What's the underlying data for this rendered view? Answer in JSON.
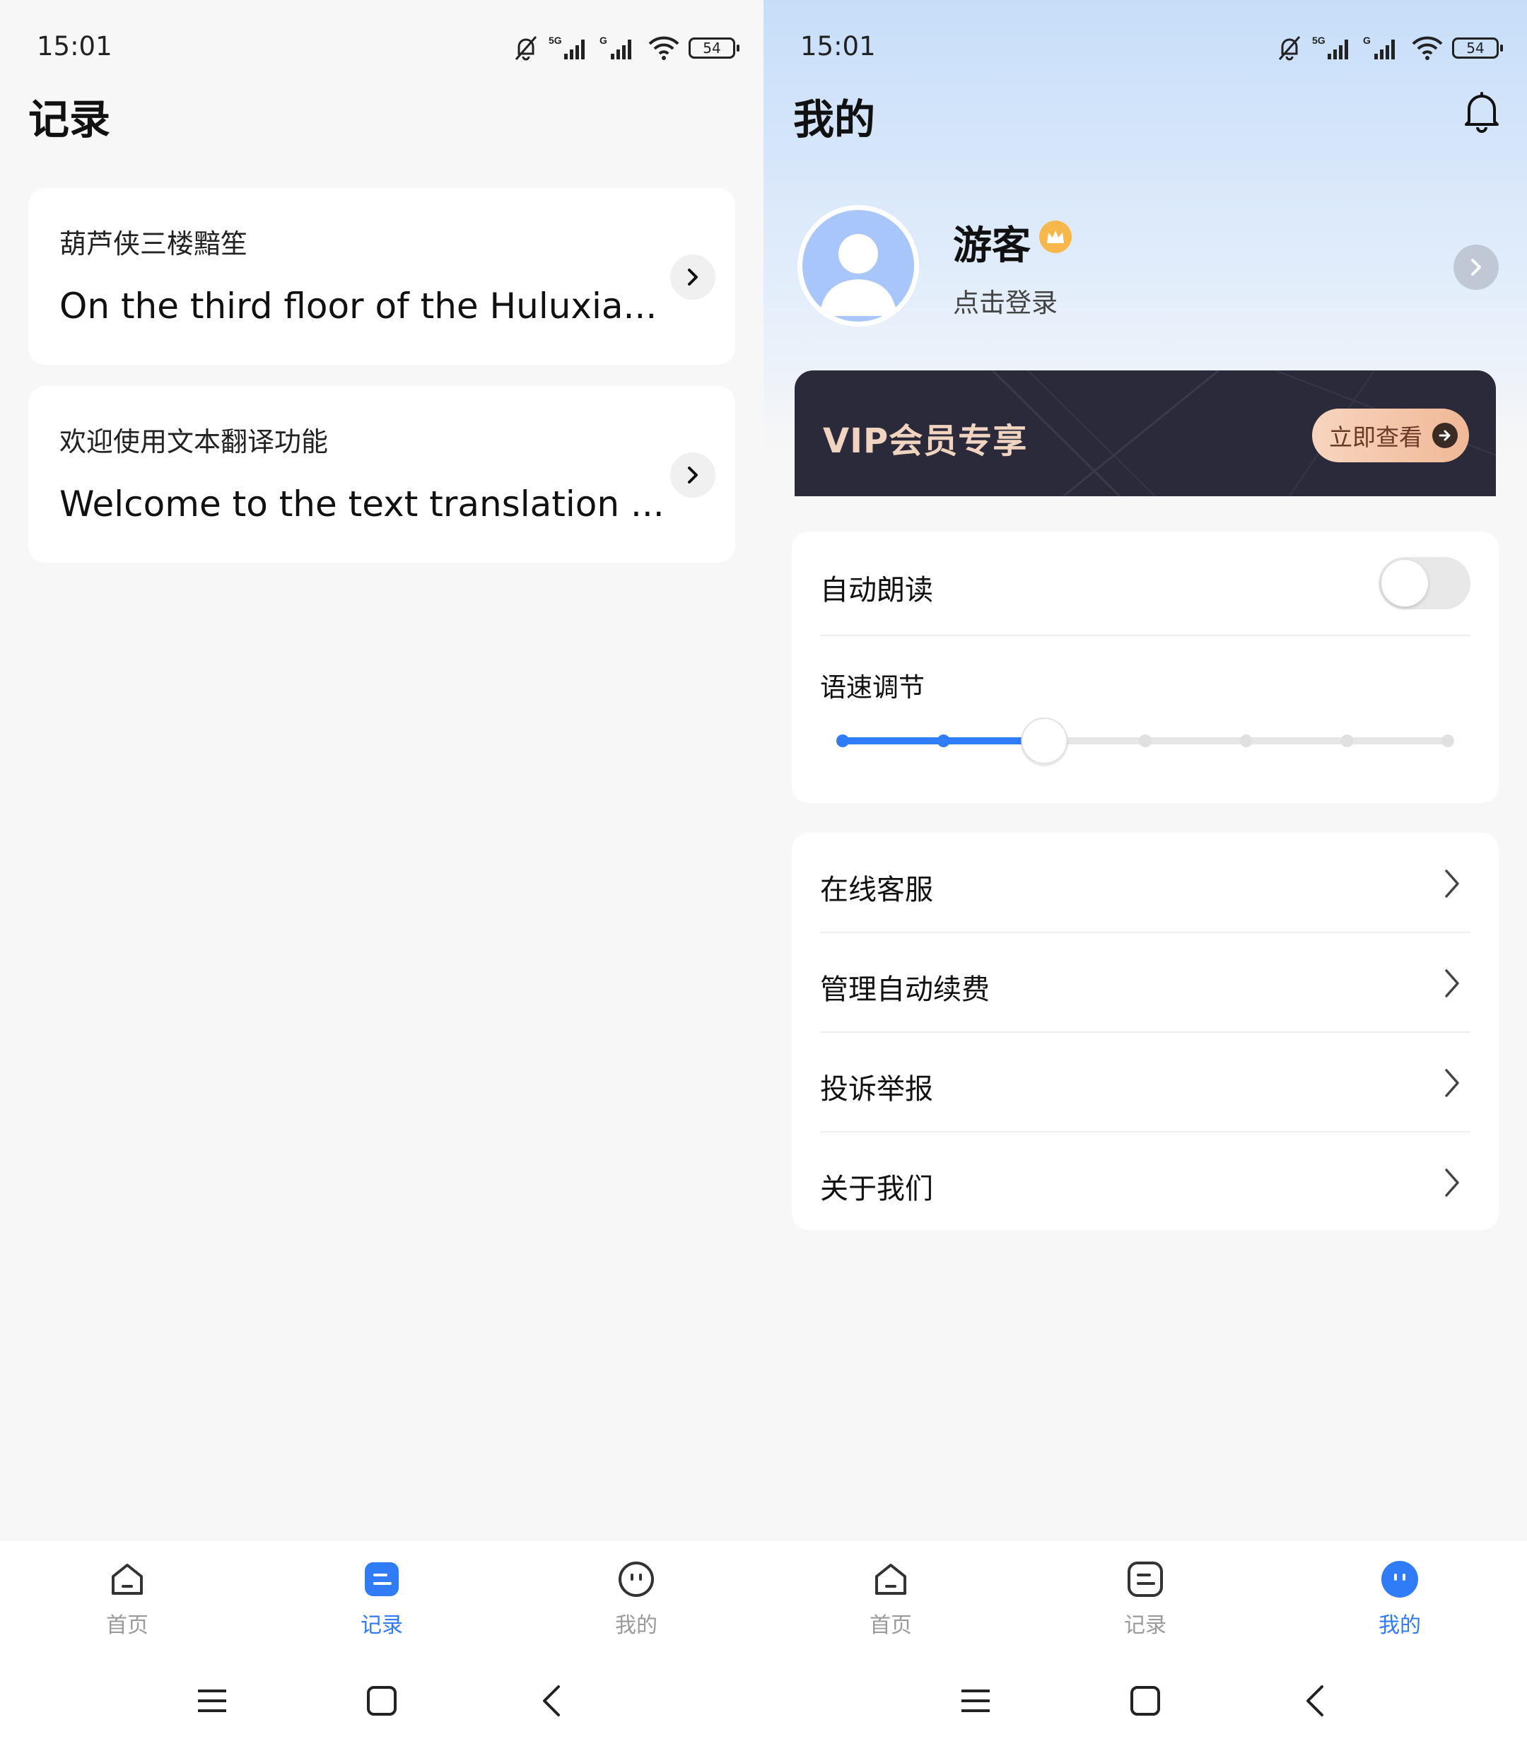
{
  "left": {
    "status": {
      "time": "15:01",
      "battery": "54"
    },
    "title": "记录",
    "records": [
      {
        "source": "葫芦侠三楼黯笙",
        "translation": "On the third floor of the Huluxia..."
      },
      {
        "source": "欢迎使用文本翻译功能",
        "translation": "Welcome to the text translation ..."
      }
    ],
    "nav": [
      {
        "label": "首页",
        "icon": "home-icon",
        "active": false
      },
      {
        "label": "记录",
        "icon": "records-icon",
        "active": true
      },
      {
        "label": "我的",
        "icon": "profile-face-icon",
        "active": false
      }
    ]
  },
  "right": {
    "status": {
      "time": "15:01",
      "battery": "54"
    },
    "title": "我的",
    "profile": {
      "name": "游客",
      "hint": "点击登录"
    },
    "vip": {
      "title": "VIP会员专享",
      "button": "立即查看"
    },
    "settings": {
      "auto_read_label": "自动朗读",
      "auto_read_on": false,
      "speed_label": "语速调节",
      "speed_level": 3,
      "speed_steps": 7
    },
    "menu": [
      {
        "label": "在线客服"
      },
      {
        "label": "管理自动续费"
      },
      {
        "label": "投诉举报"
      },
      {
        "label": "关于我们"
      }
    ],
    "nav": [
      {
        "label": "首页",
        "icon": "home-icon",
        "active": false
      },
      {
        "label": "记录",
        "icon": "records-icon",
        "active": false
      },
      {
        "label": "我的",
        "icon": "profile-face-icon",
        "active": true
      }
    ]
  },
  "colors": {
    "accent": "#2f7cf6",
    "vip_bg": "#2b2a3a",
    "vip_text": "#f1d4bf",
    "crown": "#f7b84b"
  }
}
